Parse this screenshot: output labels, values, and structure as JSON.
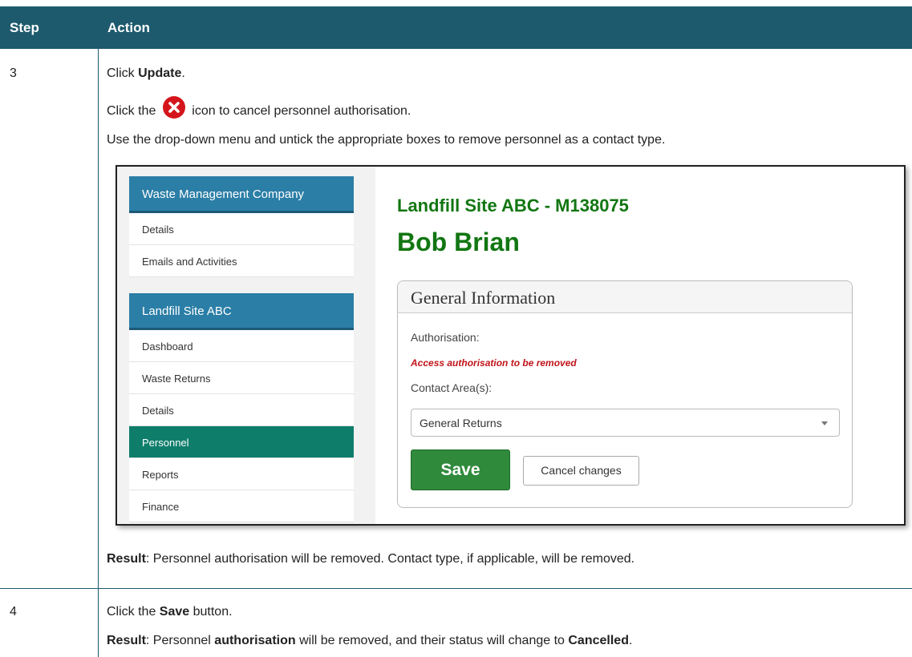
{
  "table": {
    "header": {
      "step": "Step",
      "action": "Action"
    },
    "row3": {
      "step": "3",
      "line1_prefix": "Click ",
      "line1_bold": "Update",
      "line1_suffix": ".",
      "line2_prefix": "Click the",
      "line2_icon": "cancel-x-circle-icon",
      "line2_suffix": "icon to cancel personnel authorisation.",
      "line3": "Use the drop-down menu and untick the appropriate boxes to remove personnel as a contact type.",
      "result_label": "Result",
      "result_text": ": Personnel authorisation will be removed. Contact type, if applicable, will be removed."
    },
    "row4": {
      "step": "4",
      "line1_prefix": "Click the ",
      "line1_bold": "Save",
      "line1_suffix": " button.",
      "result_label": "Result",
      "result_text_1": ": Personnel ",
      "result_bold_1": "authorisation",
      "result_text_2": " will be removed, and their status will change to ",
      "result_bold_2": "Cancelled",
      "result_text_3": "."
    }
  },
  "screenshot": {
    "sidebar": {
      "group1_title": "Waste Management Company",
      "group1_items": [
        "Details",
        "Emails and Activities"
      ],
      "group2_title": "Landfill Site ABC",
      "group2_items": [
        "Dashboard",
        "Waste Returns",
        "Details",
        "Personnel",
        "Reports",
        "Finance"
      ],
      "active_item": "Personnel"
    },
    "site_title": "Landfill Site ABC - M138075",
    "person_name": "Bob Brian",
    "panel": {
      "title": "General Information",
      "auth_label": "Authorisation:",
      "auth_status": "Access authorisation to be removed",
      "contact_label": "Contact Area(s):",
      "contact_value": "General Returns",
      "save_label": "Save",
      "cancel_label": "Cancel changes"
    }
  },
  "colors": {
    "header_bg": "#1e5a6e",
    "sidebar_head": "#2b7ea6",
    "sidebar_active": "#0e7e6b",
    "title_green": "#127612",
    "status_red": "#c0141a",
    "save_green": "#2f8a3b"
  }
}
